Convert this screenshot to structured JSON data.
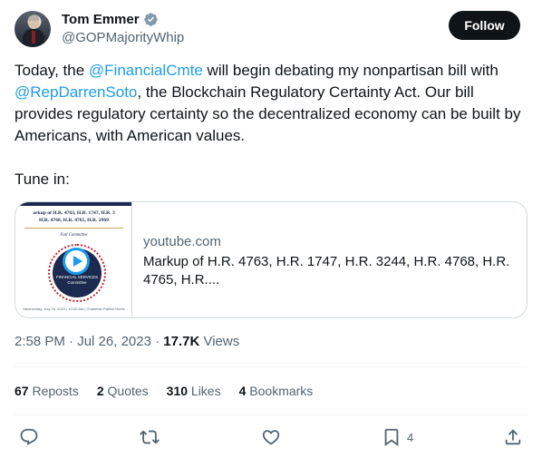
{
  "author": {
    "name": "Tom Emmer",
    "handle": "@GOPMajorityWhip",
    "verified": true,
    "follow_label": "Follow"
  },
  "tweet": {
    "text_parts": [
      {
        "t": "Today, the ",
        "mention": false
      },
      {
        "t": "@FinancialCmte",
        "mention": true
      },
      {
        "t": " will begin debating my nonpartisan bill with ",
        "mention": false
      },
      {
        "t": "@RepDarrenSoto",
        "mention": true
      },
      {
        "t": ", the Blockchain Regulatory Certainty Act. Our bill provides regulatory certainty so the decentralized economy can be built by Americans, with American values.",
        "mention": false
      }
    ],
    "tune_in": "Tune in:"
  },
  "card": {
    "domain": "youtube.com",
    "title": "Markup of H.R. 4763, H.R. 1747, H.R. 3244, H.R. 4768, H.R. 4765, H.R....",
    "thumb_line1": "arkup of H.R. 4763, H.R. 1747, H.R. 3",
    "thumb_line2": "H.R. 4768, H.R. 4765, H.R. 2969",
    "thumb_committee": "Full Committee",
    "thumb_seal_label": "FINANCIAL SERVICES Committee",
    "thumb_footer": "Wednesday, July 26, 2023 | 10:00 AM | Chairman Patrick McHe"
  },
  "meta": {
    "time": "2:58 PM",
    "sep": " · ",
    "date": "Jul 26, 2023",
    "views_count": "17.7K",
    "views_label": " Views"
  },
  "stats": [
    {
      "count": "67",
      "label": " Reposts"
    },
    {
      "count": "2",
      "label": " Quotes"
    },
    {
      "count": "310",
      "label": " Likes"
    },
    {
      "count": "4",
      "label": " Bookmarks"
    }
  ],
  "actions": {
    "bookmark_count": "4"
  },
  "colors": {
    "accent": "#1d9bf0",
    "text": "#0f1419",
    "secondary": "#536471",
    "border": "#cfd9de"
  }
}
